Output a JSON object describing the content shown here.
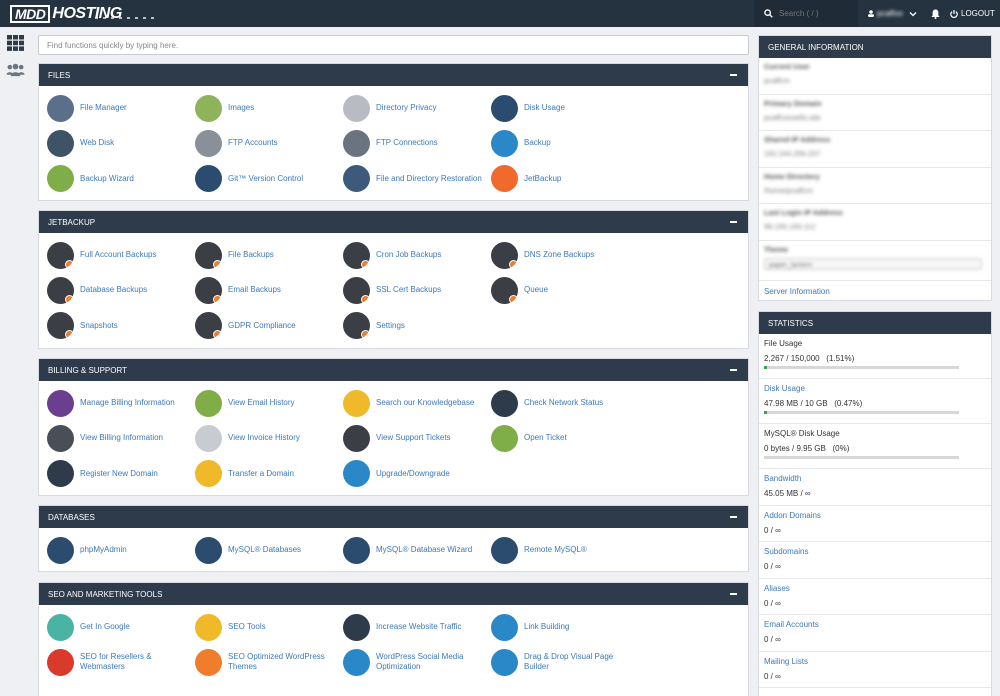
{
  "topbar": {
    "logo_box": "MDD",
    "logo_text": "HOSTING",
    "search_placeholder": "Search ( / )",
    "user_label": "pcalfoo",
    "logout_label": "LOGOUT"
  },
  "search": {
    "placeholder": "Find functions quickly by typing here."
  },
  "panels": [
    {
      "title": "FILES",
      "items": [
        {
          "label": "File Manager",
          "icon": "file-manager-icon",
          "color": "#5b6e8c"
        },
        {
          "label": "Images",
          "icon": "images-icon",
          "color": "#8fb35b"
        },
        {
          "label": "Directory Privacy",
          "icon": "folder-privacy-icon",
          "color": "#b8bcc2"
        },
        {
          "label": "Disk Usage",
          "icon": "disk-usage-icon",
          "color": "#2b4c6f"
        },
        {
          "label": "Web Disk",
          "icon": "web-disk-icon",
          "color": "#3f5366"
        },
        {
          "label": "FTP Accounts",
          "icon": "ftp-accounts-icon",
          "color": "#8a9099"
        },
        {
          "label": "FTP Connections",
          "icon": "ftp-connections-icon",
          "color": "#6a7380"
        },
        {
          "label": "Backup",
          "icon": "backup-icon",
          "color": "#2a88c9"
        },
        {
          "label": "Backup Wizard",
          "icon": "backup-wizard-icon",
          "color": "#7fae48"
        },
        {
          "label": "Git™ Version Control",
          "icon": "git-icon",
          "color": "#2b4c6f"
        },
        {
          "label": "File and Directory Restoration",
          "icon": "restore-icon",
          "color": "#3d5a7a"
        },
        {
          "label": "JetBackup",
          "icon": "jetbackup-icon",
          "color": "#ef6a2c"
        }
      ]
    },
    {
      "title": "JETBACKUP",
      "items": [
        {
          "label": "Full Account Backups",
          "icon": "full-backup-icon",
          "color": "#3b3f45"
        },
        {
          "label": "File Backups",
          "icon": "file-backup-icon",
          "color": "#3b3f45"
        },
        {
          "label": "Cron Job Backups",
          "icon": "cron-backup-icon",
          "color": "#3b3f45"
        },
        {
          "label": "DNS Zone Backups",
          "icon": "dns-backup-icon",
          "color": "#3b3f45"
        },
        {
          "label": "Database Backups",
          "icon": "database-backup-icon",
          "color": "#3b3f45"
        },
        {
          "label": "Email Backups",
          "icon": "email-backup-icon",
          "color": "#3b3f45"
        },
        {
          "label": "SSL Cert Backups",
          "icon": "ssl-backup-icon",
          "color": "#3b3f45"
        },
        {
          "label": "Queue",
          "icon": "queue-icon",
          "color": "#3b3f45"
        },
        {
          "label": "Snapshots",
          "icon": "snapshots-icon",
          "color": "#3b3f45"
        },
        {
          "label": "GDPR Compliance",
          "icon": "gdpr-icon",
          "color": "#3b3f45"
        },
        {
          "label": "Settings",
          "icon": "settings-icon",
          "color": "#3b3f45"
        }
      ]
    },
    {
      "title": "BILLING & SUPPORT",
      "items": [
        {
          "label": "Manage Billing Information",
          "icon": "billing-icon",
          "color": "#6b3f8f"
        },
        {
          "label": "View Email History",
          "icon": "email-history-icon",
          "color": "#7fae48"
        },
        {
          "label": "Search our Knowledgebase",
          "icon": "knowledgebase-icon",
          "color": "#f0b92a"
        },
        {
          "label": "Check Network Status",
          "icon": "network-status-icon",
          "color": "#2d3b4a"
        },
        {
          "label": "View Billing Information",
          "icon": "view-billing-icon",
          "color": "#4a4f57"
        },
        {
          "label": "View Invoice History",
          "icon": "invoice-history-icon",
          "color": "#c8ccd1"
        },
        {
          "label": "View Support Tickets",
          "icon": "support-tickets-icon",
          "color": "#3b3f45"
        },
        {
          "label": "Open Ticket",
          "icon": "open-ticket-icon",
          "color": "#7fae48"
        },
        {
          "label": "Register New Domain",
          "icon": "register-domain-icon",
          "color": "#2d3b4a"
        },
        {
          "label": "Transfer a Domain",
          "icon": "transfer-domain-icon",
          "color": "#f0b92a"
        },
        {
          "label": "Upgrade/Downgrade",
          "icon": "upgrade-icon",
          "color": "#2a88c9"
        }
      ]
    },
    {
      "title": "DATABASES",
      "items": [
        {
          "label": "phpMyAdmin",
          "icon": "phpmyadmin-icon",
          "color": "#2b4c6f"
        },
        {
          "label": "MySQL® Databases",
          "icon": "mysql-databases-icon",
          "color": "#2b4c6f"
        },
        {
          "label": "MySQL® Database Wizard",
          "icon": "mysql-wizard-icon",
          "color": "#2b4c6f"
        },
        {
          "label": "Remote MySQL®",
          "icon": "remote-mysql-icon",
          "color": "#2b4c6f"
        }
      ]
    },
    {
      "title": "SEO AND MARKETING TOOLS",
      "items": [
        {
          "label": "Get In Google",
          "icon": "get-in-google-icon",
          "color": "#4bb3a4"
        },
        {
          "label": "SEO Tools",
          "icon": "seo-tools-icon",
          "color": "#f0b92a"
        },
        {
          "label": "Increase Website Traffic",
          "icon": "traffic-icon",
          "color": "#2d3b4a"
        },
        {
          "label": "Link Building",
          "icon": "link-building-icon",
          "color": "#2a88c9"
        },
        {
          "label": "SEO for Resellers & Webmasters",
          "icon": "seo-resellers-icon",
          "color": "#d93a2b"
        },
        {
          "label": "SEO Optimized WordPress Themes",
          "icon": "wp-themes-icon",
          "color": "#ef7d2c"
        },
        {
          "label": "WordPress Social Media Optimization",
          "icon": "wp-social-icon",
          "color": "#2a88c9"
        },
        {
          "label": "Drag & Drop Visual Page Builder",
          "icon": "page-builder-icon",
          "color": "#2a88c9"
        }
      ]
    }
  ],
  "general_info": {
    "title": "GENERAL INFORMATION",
    "rows": [
      {
        "label": "Current User",
        "value": "pcalfcm"
      },
      {
        "label": "Primary Domain",
        "value": "pcalfconsells.site"
      },
      {
        "label": "Shared IP Address",
        "value": "192.244.256.207"
      },
      {
        "label": "Home Directory",
        "value": "/home/pcalfcm"
      },
      {
        "label": "Last Login IP Address",
        "value": "99.155.193.112"
      }
    ],
    "theme_label": "Theme",
    "theme_value": "paper_lantern",
    "server_info_link": "Server Information"
  },
  "statistics": {
    "title": "STATISTICS",
    "rows": [
      {
        "label": "File Usage",
        "value": "2,267 / 150,000   (1.51%)",
        "progress": 0.0151,
        "link": false
      },
      {
        "label": "Disk Usage",
        "value": "47.98 MB / 10 GB   (0.47%)",
        "progress": 0.0047,
        "link": true
      },
      {
        "label": "MySQL® Disk Usage",
        "value": "0 bytes / 9.95 GB   (0%)",
        "progress": 0,
        "link": false
      },
      {
        "label": "Bandwidth",
        "value": "45.05 MB / ∞",
        "link": true
      },
      {
        "label": "Addon Domains",
        "value": "0 / ∞",
        "link": true
      },
      {
        "label": "Subdomains",
        "value": "0 / ∞",
        "link": true
      },
      {
        "label": "Aliases",
        "value": "0 / ∞",
        "link": true
      },
      {
        "label": "Email Accounts",
        "value": "0 / ∞",
        "link": true
      },
      {
        "label": "Mailing Lists",
        "value": "0 / ∞",
        "link": true
      }
    ]
  },
  "colors": {
    "header": "#2d3b4a",
    "topbar": "#253341",
    "link": "#3e79b6",
    "badge": "#ef7d2c"
  }
}
